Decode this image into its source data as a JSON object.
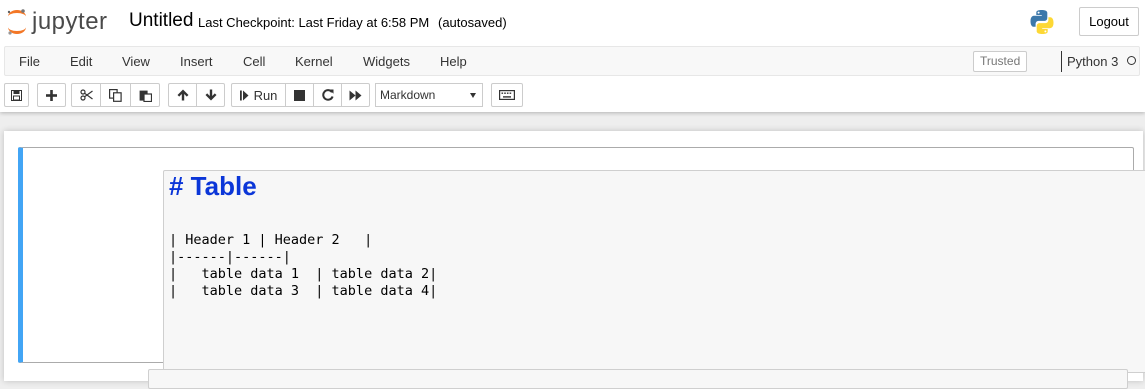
{
  "header": {
    "logo_text": "jupyter",
    "notebook_title": "Untitled",
    "checkpoint": "Last Checkpoint: Last Friday at 6:58 PM",
    "autosave_status": "(autosaved)",
    "logout_label": "Logout"
  },
  "menubar": {
    "items": [
      "File",
      "Edit",
      "View",
      "Insert",
      "Cell",
      "Kernel",
      "Widgets",
      "Help"
    ],
    "trusted_label": "Trusted",
    "kernel_name": "Python 3"
  },
  "toolbar": {
    "run_label": "Run",
    "cell_type": "Markdown",
    "icons": [
      "save-icon",
      "plus-icon",
      "cut-icon",
      "copy-icon",
      "paste-icon",
      "arrow-up-icon",
      "arrow-down-icon",
      "step-forward-icon",
      "stop-icon",
      "restart-icon",
      "fast-forward-icon",
      "keyboard-icon"
    ]
  },
  "cell": {
    "heading": "# Table",
    "lines": [
      "| Header 1 | Header 2   |",
      "|------|------|",
      "|   table data 1  | table data 2|",
      "|   table data 3  | table data 4|"
    ]
  },
  "colors": {
    "selected_cell_bar": "#42a5f5",
    "heading_color": "#0b36d8",
    "jupyter_orange": "#f37726"
  }
}
